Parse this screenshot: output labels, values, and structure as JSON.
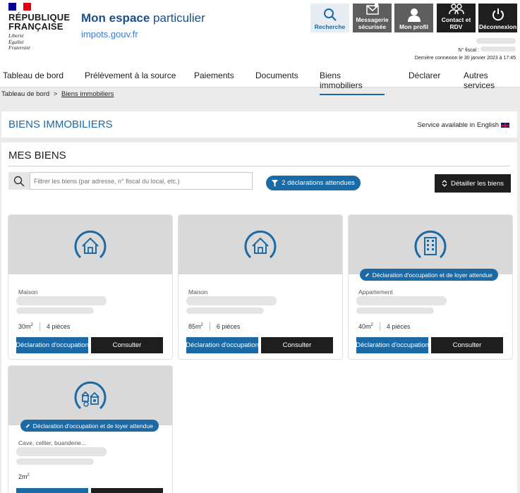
{
  "header": {
    "republic_line1": "RÉPUBLIQUE",
    "republic_line2": "FRANÇAISE",
    "motto": [
      "Liberté",
      "Égalité",
      "Fraternité"
    ],
    "title_bold": "Mon espace",
    "title_rest": " particulier",
    "site": "impots.gouv.fr",
    "buttons": {
      "search": "Recherche",
      "messaging_1": "Messagerie",
      "messaging_2": "sécurisée",
      "profile": "Mon profil",
      "contact_1": "Contact et",
      "contact_2": "RDV",
      "logout": "Déconnexion"
    },
    "fiscal_label": "N° fiscal :",
    "last_login": "Dernière connexion le 30 janvier 2023 à 17:45"
  },
  "nav": {
    "items": [
      "Tableau de bord",
      "Prélèvement à la source",
      "Paiements",
      "Documents",
      "Biens immobiliers",
      "Déclarer",
      "Autres services"
    ],
    "active": "Biens immobiliers"
  },
  "breadcrumb": {
    "home": "Tableau de bord",
    "sep": ">",
    "current": "Biens immobiliers"
  },
  "page": {
    "title": "BIENS IMMOBILIERS",
    "english": "Service available in English",
    "section": "MES BIENS",
    "search_placeholder": "Filtrer les biens (par adresse, n° fiscal du local, etc.)",
    "pending": "2 déclarations attendues",
    "detail": "Détailler les biens"
  },
  "cards": [
    {
      "type": "Maison",
      "area": "30m",
      "rooms": "4 pièces",
      "badge": "",
      "icon": "house-icon"
    },
    {
      "type": "Maison",
      "area": "85m",
      "rooms": "6 pièces",
      "badge": "",
      "icon": "house-icon"
    },
    {
      "type": "Appartement",
      "area": "40m",
      "rooms": "4 pièces",
      "badge": "Déclaration d'occupation et de loyer attendue",
      "icon": "building-icon"
    },
    {
      "type": "Cave, cellier, buanderie...",
      "area": "2m",
      "rooms": "",
      "badge": "Déclaration d'occupation et de loyer attendue",
      "icon": "annex-icon"
    }
  ],
  "card_buttons": {
    "declare": "Déclaration d'occupation",
    "consult": "Consulter"
  },
  "area_sup": "2",
  "colors": {
    "primary": "#1b6aa6",
    "dark": "#1e1e1e",
    "grey_button": "#5e5e5e"
  }
}
